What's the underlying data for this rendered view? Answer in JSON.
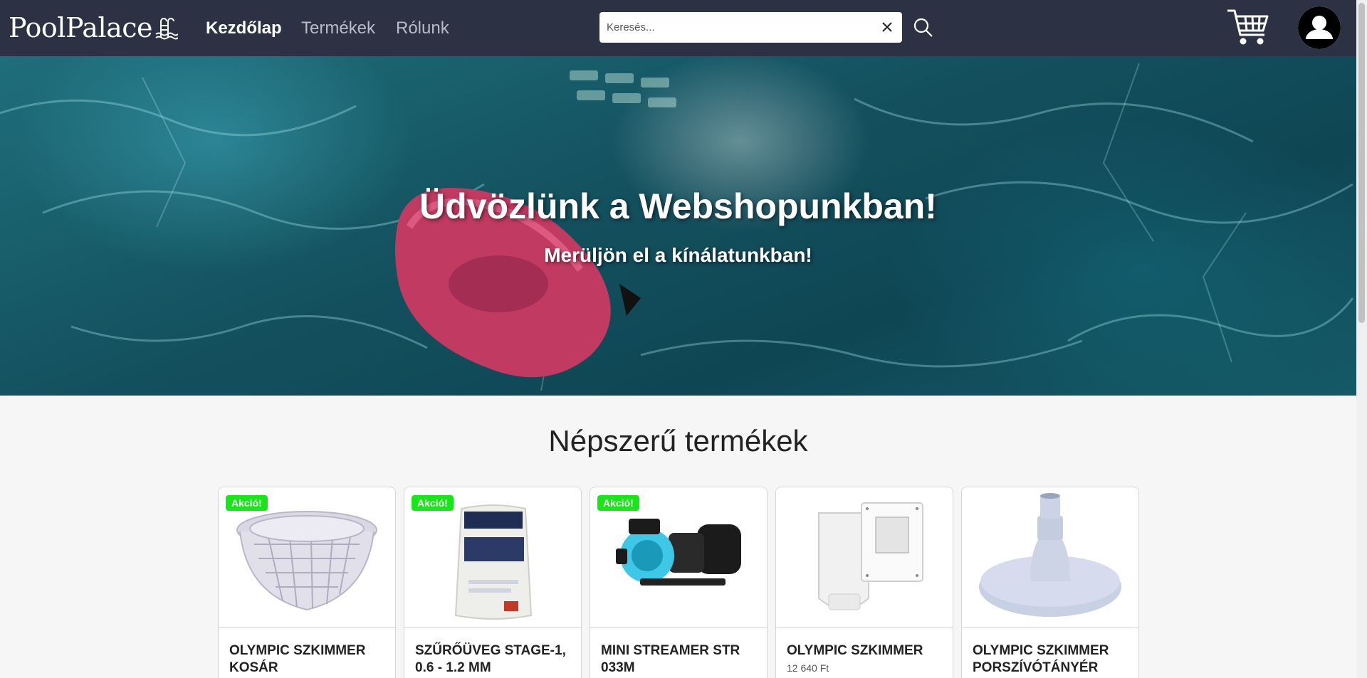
{
  "brand": {
    "name": "PoolPalace"
  },
  "nav": {
    "links": [
      {
        "label": "Kezdőlap",
        "active": true
      },
      {
        "label": "Termékek",
        "active": false
      },
      {
        "label": "Rólunk",
        "active": false
      }
    ]
  },
  "search": {
    "placeholder": "Keresés...",
    "value": ""
  },
  "hero": {
    "title": "Üdvözlünk a Webshopunkban!",
    "subtitle": "Merüljön el a kínálatunkban!"
  },
  "popular": {
    "title": "Népszerű termékek",
    "products": [
      {
        "name": "Olympic Szkimmer Kosár",
        "badge": "Akció!",
        "price": "",
        "icon": "skimmer-basket"
      },
      {
        "name": "Szűrőüveg Stage-1, 0.6 - 1.2 mm",
        "badge": "Akció!",
        "price": "",
        "icon": "filter-glass-bag"
      },
      {
        "name": "Mini Streamer STR 033M",
        "badge": "Akció!",
        "price": "",
        "icon": "pool-pump"
      },
      {
        "name": "Olympic Szkimmer",
        "badge": "",
        "price": "12 640 Ft",
        "icon": "skimmer"
      },
      {
        "name": "Olympic Szkimmer Porszívótányér",
        "badge": "",
        "price": "",
        "icon": "vacuum-plate"
      }
    ]
  },
  "colors": {
    "navbar": "#2c3244",
    "badge": "#19e619",
    "page_bg": "#f6f6f6"
  }
}
